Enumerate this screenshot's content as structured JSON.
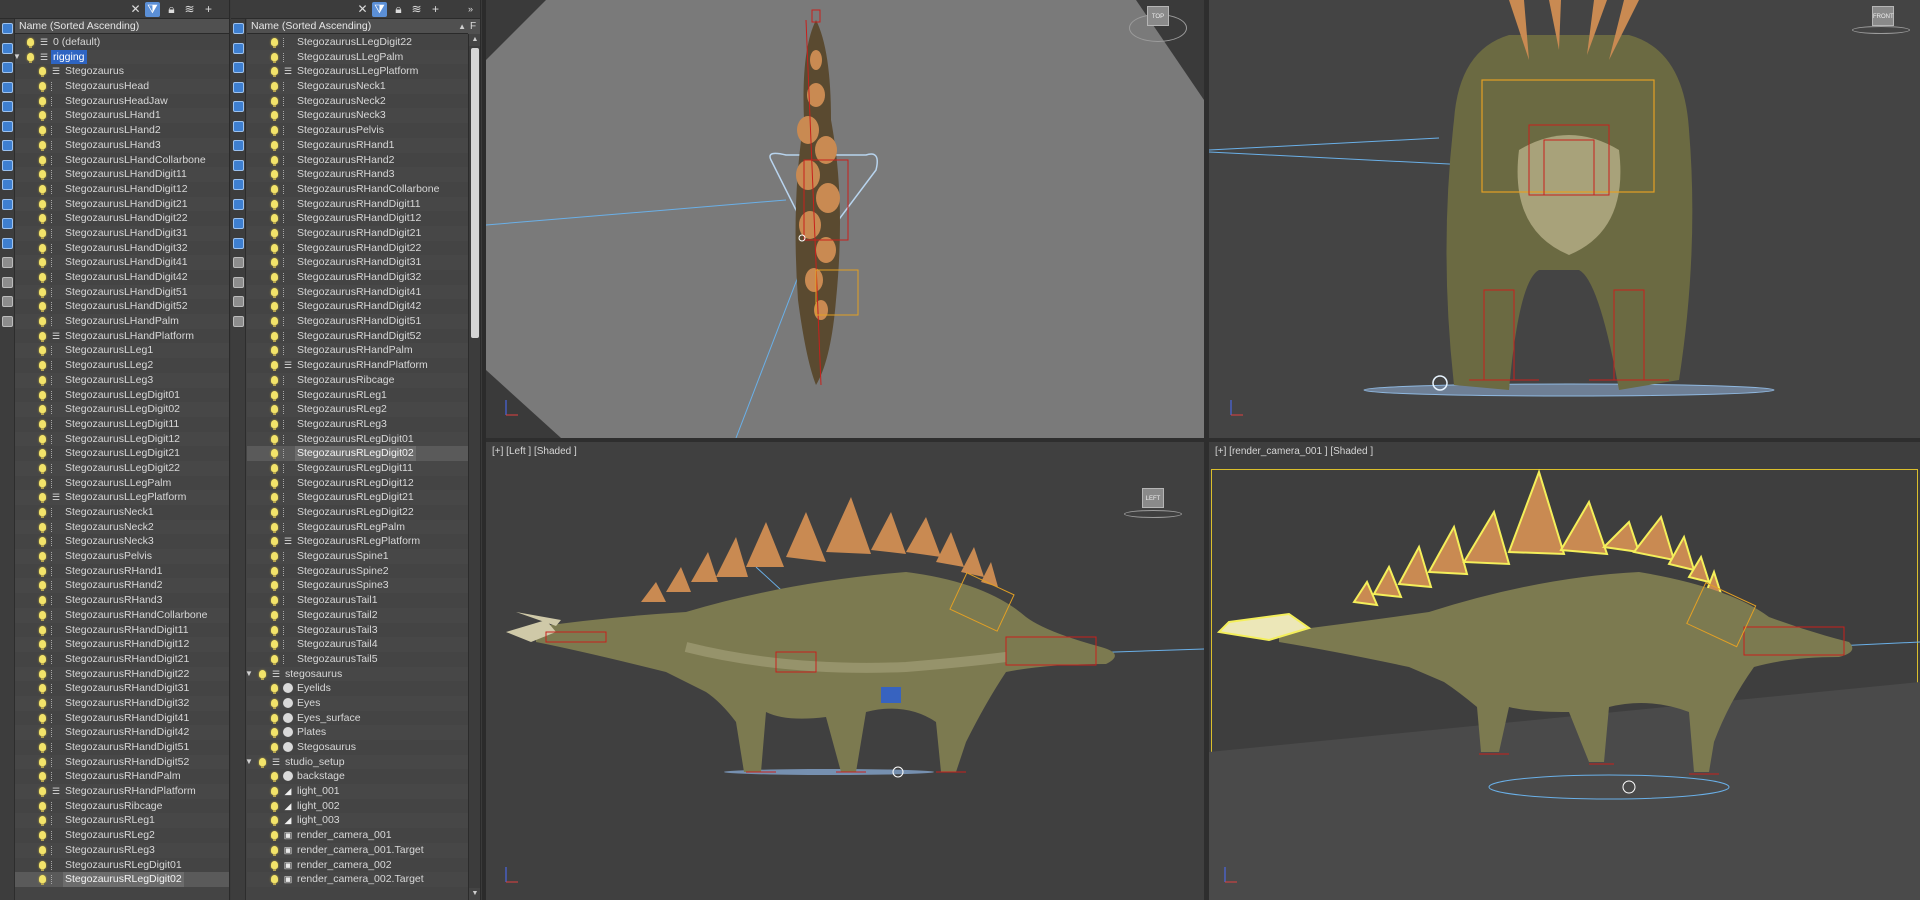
{
  "explorer_left": {
    "header": "Name (Sorted Ascending)",
    "rows": [
      {
        "label": "0 (default)",
        "indent": 1,
        "type": "layer"
      },
      {
        "label": "rigging",
        "indent": 1,
        "type": "layer",
        "expanded": true,
        "highlight": true
      },
      {
        "label": "Stegozaurus",
        "indent": 2,
        "type": "layer"
      },
      {
        "label": "StegozaurusHead",
        "indent": 2,
        "type": "bone"
      },
      {
        "label": "StegozaurusHeadJaw",
        "indent": 2,
        "type": "bone"
      },
      {
        "label": "StegozaurusLHand1",
        "indent": 2,
        "type": "bone"
      },
      {
        "label": "StegozaurusLHand2",
        "indent": 2,
        "type": "bone"
      },
      {
        "label": "StegozaurusLHand3",
        "indent": 2,
        "type": "bone"
      },
      {
        "label": "StegozaurusLHandCollarbone",
        "indent": 2,
        "type": "bone"
      },
      {
        "label": "StegozaurusLHandDigit11",
        "indent": 2,
        "type": "bone"
      },
      {
        "label": "StegozaurusLHandDigit12",
        "indent": 2,
        "type": "bone"
      },
      {
        "label": "StegozaurusLHandDigit21",
        "indent": 2,
        "type": "bone"
      },
      {
        "label": "StegozaurusLHandDigit22",
        "indent": 2,
        "type": "bone"
      },
      {
        "label": "StegozaurusLHandDigit31",
        "indent": 2,
        "type": "bone"
      },
      {
        "label": "StegozaurusLHandDigit32",
        "indent": 2,
        "type": "bone"
      },
      {
        "label": "StegozaurusLHandDigit41",
        "indent": 2,
        "type": "bone"
      },
      {
        "label": "StegozaurusLHandDigit42",
        "indent": 2,
        "type": "bone"
      },
      {
        "label": "StegozaurusLHandDigit51",
        "indent": 2,
        "type": "bone"
      },
      {
        "label": "StegozaurusLHandDigit52",
        "indent": 2,
        "type": "bone"
      },
      {
        "label": "StegozaurusLHandPalm",
        "indent": 2,
        "type": "bone"
      },
      {
        "label": "StegozaurusLHandPlatform",
        "indent": 2,
        "type": "layer"
      },
      {
        "label": "StegozaurusLLeg1",
        "indent": 2,
        "type": "bone"
      },
      {
        "label": "StegozaurusLLeg2",
        "indent": 2,
        "type": "bone"
      },
      {
        "label": "StegozaurusLLeg3",
        "indent": 2,
        "type": "bone"
      },
      {
        "label": "StegozaurusLLegDigit01",
        "indent": 2,
        "type": "bone"
      },
      {
        "label": "StegozaurusLLegDigit02",
        "indent": 2,
        "type": "bone"
      },
      {
        "label": "StegozaurusLLegDigit11",
        "indent": 2,
        "type": "bone"
      },
      {
        "label": "StegozaurusLLegDigit12",
        "indent": 2,
        "type": "bone"
      },
      {
        "label": "StegozaurusLLegDigit21",
        "indent": 2,
        "type": "bone"
      },
      {
        "label": "StegozaurusLLegDigit22",
        "indent": 2,
        "type": "bone"
      },
      {
        "label": "StegozaurusLLegPalm",
        "indent": 2,
        "type": "bone"
      },
      {
        "label": "StegozaurusLLegPlatform",
        "indent": 2,
        "type": "layer"
      },
      {
        "label": "StegozaurusNeck1",
        "indent": 2,
        "type": "bone"
      },
      {
        "label": "StegozaurusNeck2",
        "indent": 2,
        "type": "bone"
      },
      {
        "label": "StegozaurusNeck3",
        "indent": 2,
        "type": "bone"
      },
      {
        "label": "StegozaurusPelvis",
        "indent": 2,
        "type": "bone"
      },
      {
        "label": "StegozaurusRHand1",
        "indent": 2,
        "type": "bone"
      },
      {
        "label": "StegozaurusRHand2",
        "indent": 2,
        "type": "bone"
      },
      {
        "label": "StegozaurusRHand3",
        "indent": 2,
        "type": "bone"
      },
      {
        "label": "StegozaurusRHandCollarbone",
        "indent": 2,
        "type": "bone"
      },
      {
        "label": "StegozaurusRHandDigit11",
        "indent": 2,
        "type": "bone"
      },
      {
        "label": "StegozaurusRHandDigit12",
        "indent": 2,
        "type": "bone"
      },
      {
        "label": "StegozaurusRHandDigit21",
        "indent": 2,
        "type": "bone"
      },
      {
        "label": "StegozaurusRHandDigit22",
        "indent": 2,
        "type": "bone"
      },
      {
        "label": "StegozaurusRHandDigit31",
        "indent": 2,
        "type": "bone"
      },
      {
        "label": "StegozaurusRHandDigit32",
        "indent": 2,
        "type": "bone"
      },
      {
        "label": "StegozaurusRHandDigit41",
        "indent": 2,
        "type": "bone"
      },
      {
        "label": "StegozaurusRHandDigit42",
        "indent": 2,
        "type": "bone"
      },
      {
        "label": "StegozaurusRHandDigit51",
        "indent": 2,
        "type": "bone"
      },
      {
        "label": "StegozaurusRHandDigit52",
        "indent": 2,
        "type": "bone"
      },
      {
        "label": "StegozaurusRHandPalm",
        "indent": 2,
        "type": "bone"
      },
      {
        "label": "StegozaurusRHandPlatform",
        "indent": 2,
        "type": "layer"
      },
      {
        "label": "StegozaurusRibcage",
        "indent": 2,
        "type": "bone"
      },
      {
        "label": "StegozaurusRLeg1",
        "indent": 2,
        "type": "bone"
      },
      {
        "label": "StegozaurusRLeg2",
        "indent": 2,
        "type": "bone"
      },
      {
        "label": "StegozaurusRLeg3",
        "indent": 2,
        "type": "bone"
      },
      {
        "label": "StegozaurusRLegDigit01",
        "indent": 2,
        "type": "bone"
      },
      {
        "label": "StegozaurusRLegDigit02",
        "indent": 2,
        "type": "bone",
        "selected": true
      }
    ]
  },
  "explorer_right": {
    "header": "Name (Sorted Ascending)",
    "header_extra": "F",
    "rows": [
      {
        "label": "StegozaurusLLegDigit22",
        "indent": 2,
        "type": "bone"
      },
      {
        "label": "StegozaurusLLegPalm",
        "indent": 2,
        "type": "bone"
      },
      {
        "label": "StegozaurusLLegPlatform",
        "indent": 2,
        "type": "layer"
      },
      {
        "label": "StegozaurusNeck1",
        "indent": 2,
        "type": "bone"
      },
      {
        "label": "StegozaurusNeck2",
        "indent": 2,
        "type": "bone"
      },
      {
        "label": "StegozaurusNeck3",
        "indent": 2,
        "type": "bone"
      },
      {
        "label": "StegozaurusPelvis",
        "indent": 2,
        "type": "bone"
      },
      {
        "label": "StegozaurusRHand1",
        "indent": 2,
        "type": "bone"
      },
      {
        "label": "StegozaurusRHand2",
        "indent": 2,
        "type": "bone"
      },
      {
        "label": "StegozaurusRHand3",
        "indent": 2,
        "type": "bone"
      },
      {
        "label": "StegozaurusRHandCollarbone",
        "indent": 2,
        "type": "bone"
      },
      {
        "label": "StegozaurusRHandDigit11",
        "indent": 2,
        "type": "bone"
      },
      {
        "label": "StegozaurusRHandDigit12",
        "indent": 2,
        "type": "bone"
      },
      {
        "label": "StegozaurusRHandDigit21",
        "indent": 2,
        "type": "bone"
      },
      {
        "label": "StegozaurusRHandDigit22",
        "indent": 2,
        "type": "bone"
      },
      {
        "label": "StegozaurusRHandDigit31",
        "indent": 2,
        "type": "bone"
      },
      {
        "label": "StegozaurusRHandDigit32",
        "indent": 2,
        "type": "bone"
      },
      {
        "label": "StegozaurusRHandDigit41",
        "indent": 2,
        "type": "bone"
      },
      {
        "label": "StegozaurusRHandDigit42",
        "indent": 2,
        "type": "bone"
      },
      {
        "label": "StegozaurusRHandDigit51",
        "indent": 2,
        "type": "bone"
      },
      {
        "label": "StegozaurusRHandDigit52",
        "indent": 2,
        "type": "bone"
      },
      {
        "label": "StegozaurusRHandPalm",
        "indent": 2,
        "type": "bone"
      },
      {
        "label": "StegozaurusRHandPlatform",
        "indent": 2,
        "type": "layer"
      },
      {
        "label": "StegozaurusRibcage",
        "indent": 2,
        "type": "bone"
      },
      {
        "label": "StegozaurusRLeg1",
        "indent": 2,
        "type": "bone"
      },
      {
        "label": "StegozaurusRLeg2",
        "indent": 2,
        "type": "bone"
      },
      {
        "label": "StegozaurusRLeg3",
        "indent": 2,
        "type": "bone"
      },
      {
        "label": "StegozaurusRLegDigit01",
        "indent": 2,
        "type": "bone"
      },
      {
        "label": "StegozaurusRLegDigit02",
        "indent": 2,
        "type": "bone",
        "selected": true
      },
      {
        "label": "StegozaurusRLegDigit11",
        "indent": 2,
        "type": "bone"
      },
      {
        "label": "StegozaurusRLegDigit12",
        "indent": 2,
        "type": "bone"
      },
      {
        "label": "StegozaurusRLegDigit21",
        "indent": 2,
        "type": "bone"
      },
      {
        "label": "StegozaurusRLegDigit22",
        "indent": 2,
        "type": "bone"
      },
      {
        "label": "StegozaurusRLegPalm",
        "indent": 2,
        "type": "bone"
      },
      {
        "label": "StegozaurusRLegPlatform",
        "indent": 2,
        "type": "layer"
      },
      {
        "label": "StegozaurusSpine1",
        "indent": 2,
        "type": "bone"
      },
      {
        "label": "StegozaurusSpine2",
        "indent": 2,
        "type": "bone"
      },
      {
        "label": "StegozaurusSpine3",
        "indent": 2,
        "type": "bone"
      },
      {
        "label": "StegozaurusTail1",
        "indent": 2,
        "type": "bone"
      },
      {
        "label": "StegozaurusTail2",
        "indent": 2,
        "type": "bone"
      },
      {
        "label": "StegozaurusTail3",
        "indent": 2,
        "type": "bone"
      },
      {
        "label": "StegozaurusTail4",
        "indent": 2,
        "type": "bone"
      },
      {
        "label": "StegozaurusTail5",
        "indent": 2,
        "type": "bone"
      },
      {
        "label": "stegosaurus",
        "indent": 1,
        "type": "layer",
        "expanded": true
      },
      {
        "label": "Eyelids",
        "indent": 2,
        "type": "sphere"
      },
      {
        "label": "Eyes",
        "indent": 2,
        "type": "sphere"
      },
      {
        "label": "Eyes_surface",
        "indent": 2,
        "type": "sphere"
      },
      {
        "label": "Plates",
        "indent": 2,
        "type": "sphere"
      },
      {
        "label": "Stegosaurus",
        "indent": 2,
        "type": "sphere"
      },
      {
        "label": "studio_setup",
        "indent": 1,
        "type": "layer",
        "expanded": true
      },
      {
        "label": "backstage",
        "indent": 2,
        "type": "sphere"
      },
      {
        "label": "light_001",
        "indent": 2,
        "type": "light"
      },
      {
        "label": "light_002",
        "indent": 2,
        "type": "light"
      },
      {
        "label": "light_003",
        "indent": 2,
        "type": "light"
      },
      {
        "label": "render_camera_001",
        "indent": 2,
        "type": "camera"
      },
      {
        "label": "render_camera_001.Target",
        "indent": 2,
        "type": "camera"
      },
      {
        "label": "render_camera_002",
        "indent": 2,
        "type": "camera"
      },
      {
        "label": "render_camera_002.Target",
        "indent": 2,
        "type": "camera"
      }
    ]
  },
  "viewports": {
    "top": {
      "label": "",
      "cube_label": "TOP"
    },
    "front": {
      "label": "",
      "cube_label": "FRONT"
    },
    "left": {
      "label": "[+] [Left ] [Shaded ]",
      "cube_label": "LEFT"
    },
    "camera": {
      "label": "[+] [render_camera_001 ] [Shaded ]"
    }
  },
  "colors": {
    "selection_frame": "#dbbf2c",
    "bone_red": "#c8201c",
    "helper_orange": "#e3a024",
    "selection_yellow": "#f4ef5a",
    "guide_blue": "#6ab0e8"
  }
}
